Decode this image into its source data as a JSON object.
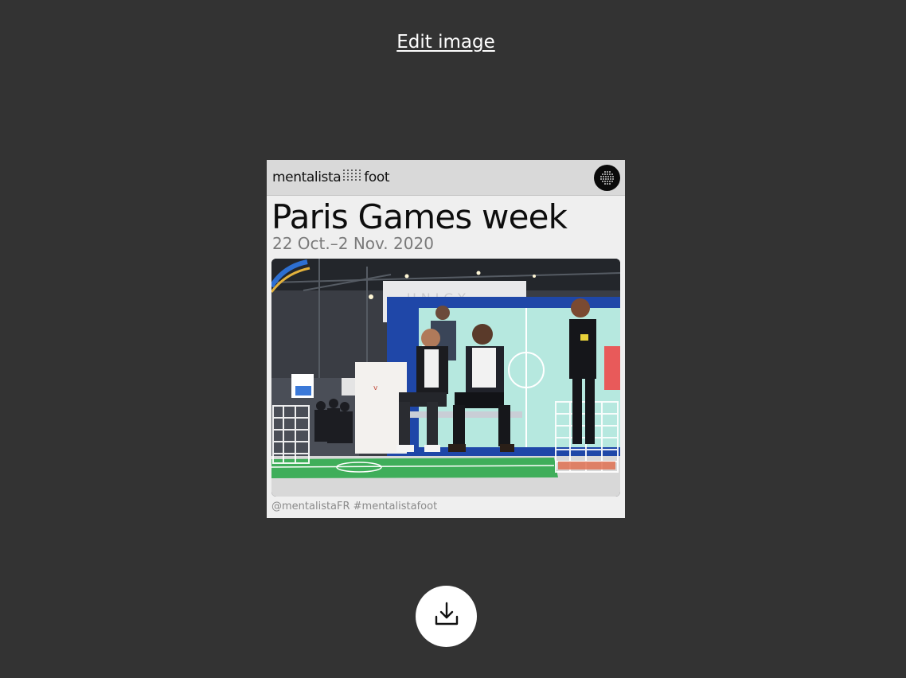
{
  "edit_link": {
    "label": "Edit image"
  },
  "card": {
    "brand_left": "mentalista",
    "brand_right": "foot",
    "badge_icon": "dot-grid-logo-icon",
    "title": "Paris Games week",
    "dates": "22 Oct.–2 Nov. 2020",
    "photo": {
      "stand_sign": "UNIGY",
      "alt": "Two players seated in front of a mini football pitch"
    },
    "footer": "@mentalistaFR #mentalistafoot"
  },
  "download": {
    "icon": "download-icon"
  },
  "colors": {
    "background": "#333333",
    "card": "#efefef",
    "header": "#d9d9d9",
    "button": "#ffffff",
    "pitch_green": "#3fae5a"
  }
}
